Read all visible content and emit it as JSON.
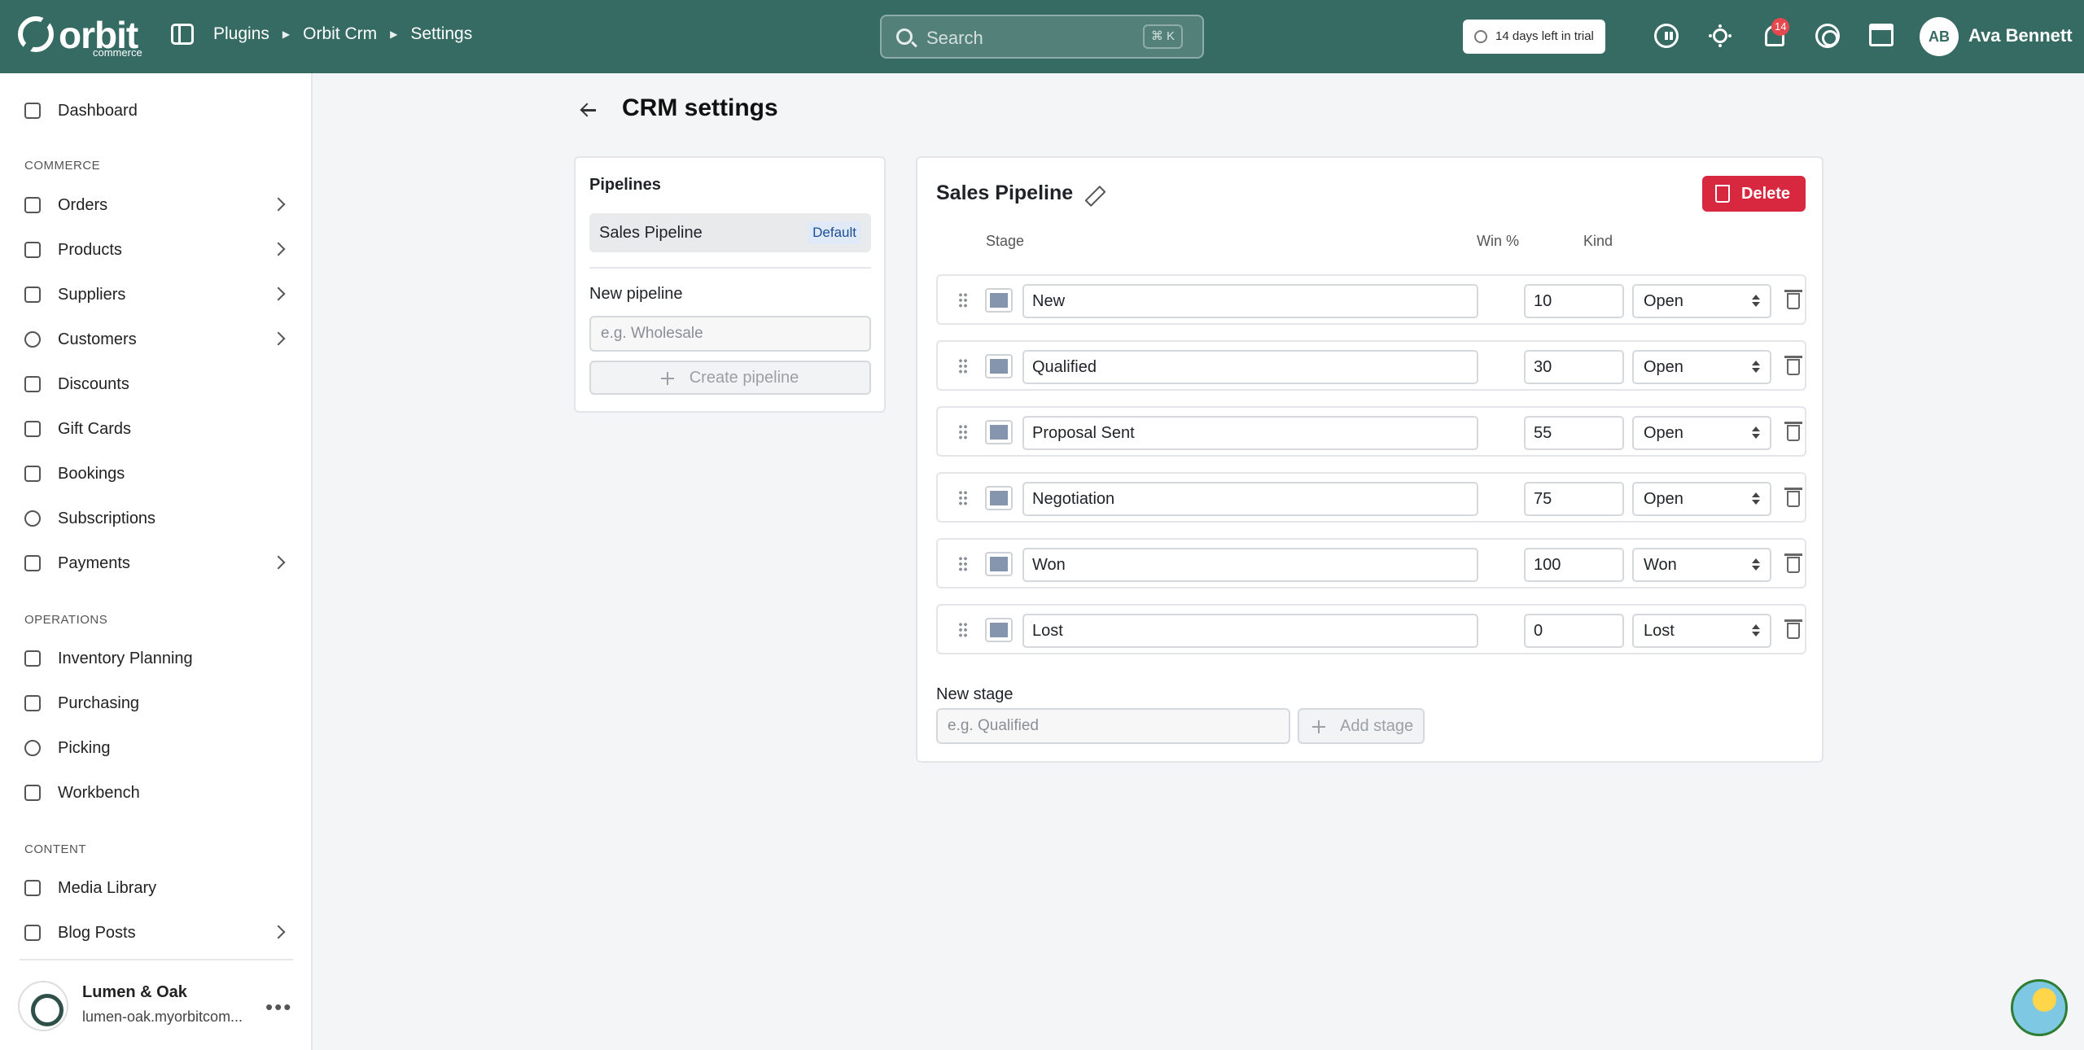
{
  "brand": {
    "name": "orbit",
    "sub": "commerce"
  },
  "breadcrumb": [
    "Plugins",
    "Orbit Crm",
    "Settings"
  ],
  "search": {
    "placeholder": "Search",
    "shortcut": "⌘ K"
  },
  "trial": "14 days left in trial",
  "notifications": {
    "count": "14"
  },
  "user": {
    "initials": "AB",
    "name": "Ava Bennett"
  },
  "sidebar": {
    "dashboard": "Dashboard",
    "sections": {
      "commerce": "COMMERCE",
      "operations": "OPERATIONS",
      "content": "CONTENT"
    },
    "commerce": [
      "Orders",
      "Products",
      "Suppliers",
      "Customers",
      "Discounts",
      "Gift Cards",
      "Bookings",
      "Subscriptions",
      "Payments"
    ],
    "operations": [
      "Inventory Planning",
      "Purchasing",
      "Picking",
      "Workbench"
    ],
    "content": [
      "Media Library",
      "Blog Posts"
    ],
    "store": {
      "name": "Lumen & Oak",
      "url": "lumen-oak.myorbitcom..."
    }
  },
  "page": {
    "title": "CRM settings"
  },
  "pipelines": {
    "heading": "Pipelines",
    "items": [
      {
        "name": "Sales Pipeline",
        "badge": "Default"
      }
    ],
    "new_label": "New pipeline",
    "new_placeholder": "e.g. Wholesale",
    "create_label": "Create pipeline"
  },
  "pipeline": {
    "name": "Sales Pipeline",
    "delete_label": "Delete",
    "columns": {
      "stage": "Stage",
      "win": "Win %",
      "kind": "Kind"
    },
    "stages": [
      {
        "name": "New",
        "win": "10",
        "kind": "Open"
      },
      {
        "name": "Qualified",
        "win": "30",
        "kind": "Open"
      },
      {
        "name": "Proposal Sent",
        "win": "55",
        "kind": "Open"
      },
      {
        "name": "Negotiation",
        "win": "75",
        "kind": "Open"
      },
      {
        "name": "Won",
        "win": "100",
        "kind": "Won"
      },
      {
        "name": "Lost",
        "win": "0",
        "kind": "Lost"
      }
    ],
    "swatch_color": "#8495ad",
    "new_stage_label": "New stage",
    "new_stage_placeholder": "e.g. Qualified",
    "add_stage_label": "Add stage"
  },
  "colors": {
    "topbar": "#356b63",
    "danger": "#d8283f",
    "default_badge": "#dfe9f7"
  }
}
